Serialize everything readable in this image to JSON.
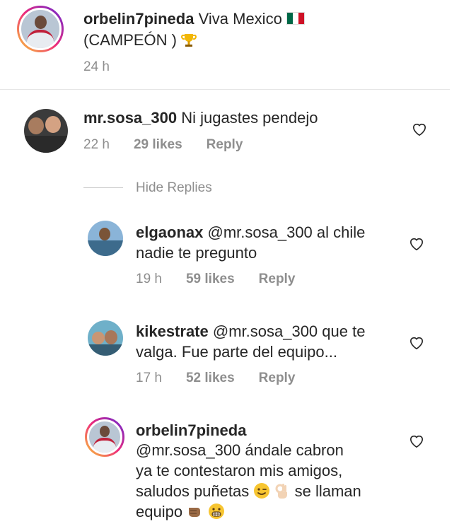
{
  "post": {
    "username": "orbelin7pineda",
    "caption_line1": "Viva Mexico",
    "caption_line2": "(CAMPEÓN )",
    "time": "24 h"
  },
  "comment": {
    "username": "mr.sosa_300",
    "text": "Ni jugastes pendejo",
    "time": "22 h",
    "likes": "29 likes",
    "reply": "Reply",
    "hide_replies": "Hide Replies"
  },
  "replies": [
    {
      "username": "elgaonax",
      "line1": "@mr.sosa_300 al chile",
      "line2": "nadie te pregunto",
      "time": "19 h",
      "likes": "59 likes",
      "reply": "Reply"
    },
    {
      "username": "kikestrate",
      "line1": "@mr.sosa_300 que te",
      "line2": "valga. Fue parte del equipo...",
      "time": "17 h",
      "likes": "52 likes",
      "reply": "Reply"
    },
    {
      "username": "orbelin7pineda",
      "line1": "@mr.sosa_300 ándale cabron",
      "line2": "ya te contestaron mis amigos,",
      "line3": "saludos puñetas",
      "line3b": "se llaman",
      "line4": "equipo"
    }
  ],
  "icons": [
    "mexico-flag-icon",
    "trophy-icon",
    "heart-icon",
    "wink-emoji-icon",
    "ok-hand-icon",
    "fist-bump-icon",
    "grimace-emoji-icon"
  ]
}
